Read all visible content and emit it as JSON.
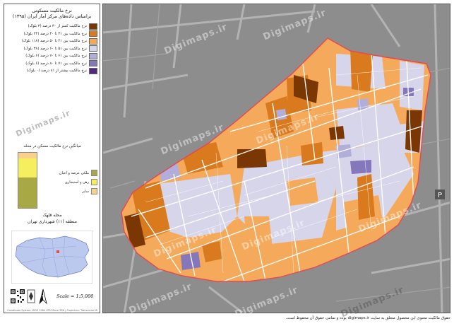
{
  "title_line1": "نرخ مالکیت مسکونی",
  "title_line2": "براساس داده‌های مرکز آمار ایران (۱۳۹۵)",
  "legend": [
    {
      "label": "نرخ مالکیت کمتر از ۳۰ درصد (۳ بلوک)",
      "color": "#7a3603"
    },
    {
      "label": "نرخ مالکیت بین ۳۱ تا ۴۰ درصد (۲۴ بلوک)",
      "color": "#d97a1e"
    },
    {
      "label": "نرخ مالکیت بین ۴۱ تا ۵۰ درصد (۱۱۸ بلوک)",
      "color": "#f5a95a"
    },
    {
      "label": "نرخ مالکیت بین ۵۱ تا ۶۰ درصد (۳۸ بلوک)",
      "color": "#d7d5ea"
    },
    {
      "label": "نرخ مالکیت بین ۶۱ تا ۷۰ درصد (۶ بلوک)",
      "color": "#b2aedb"
    },
    {
      "label": "نرخ مالکیت بین ۷۱ تا ۸۰ درصد (۶ بلوک)",
      "color": "#8577bb"
    },
    {
      "label": "نرخ مالکیت بیشتر از ۸۱ درصد (۰ بلوک)",
      "color": "#4f2680"
    }
  ],
  "bar_title": "میانگین نرخ مالکیت مسکن در محله",
  "bar_legend": [
    {
      "label": "ملکی عرصه و اعیان",
      "color": "#a8a845"
    },
    {
      "label": "رهن و استیجاری",
      "color": "#f5ee5f"
    },
    {
      "label": "سایر",
      "color": "#f8d28c"
    }
  ],
  "bar_segments": [
    {
      "fraction": 0.55,
      "color": "#a8a845"
    },
    {
      "fraction": 0.35,
      "color": "#f5ee5f"
    },
    {
      "fraction": 0.1,
      "color": "#f8d28c"
    }
  ],
  "region_line1": "محله قلهک",
  "region_line2": "منطقه (۱۱) شهرداری تهران",
  "scale": "Scale = 1:5,000",
  "north_label": "N",
  "credit": "Coordinate System: WGS 1984 UTM Zone 39N | Projection: Transverse Mercator",
  "copyright": "حقوق مالکیت معنوی این محصول متعلق به سایت digimaps.ir بوده و تمامی حقوق آن محفوظ است.",
  "watermark": "Digimaps.ir",
  "colors": {
    "map_bg": "#8d8d8d",
    "boundary": "#e8484f"
  }
}
